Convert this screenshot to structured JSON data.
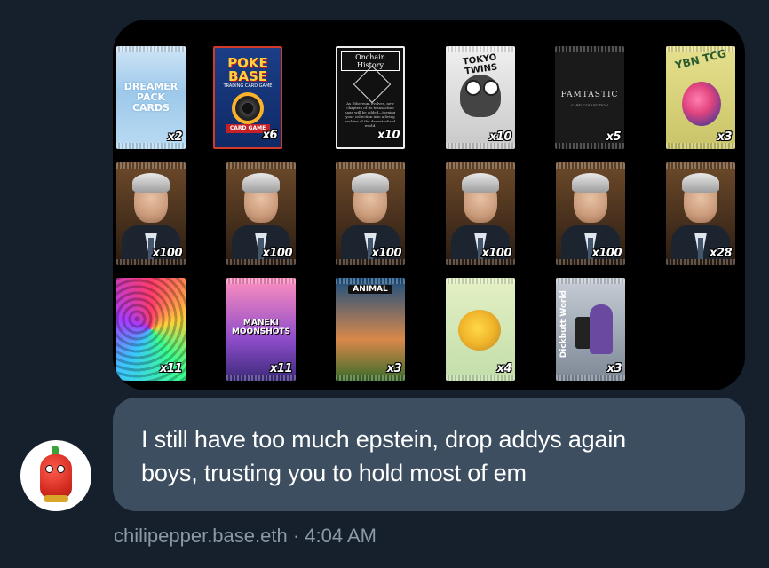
{
  "media": {
    "packs": [
      {
        "name": "dreamer-pack",
        "title": "DREAMER PACK CARDS",
        "count": "x2"
      },
      {
        "name": "poke-base-pack",
        "title": "POKE BASE",
        "subtitle": "TRADING CARD GAME",
        "footer": "CARD GAME",
        "count": "x6"
      },
      {
        "name": "onchain-history-pack",
        "title": "Onchain History",
        "text": "As Ethereum evolves, new chapters of its transaction saga will be added—turning your collection into a living archive of the decentralized world.",
        "count": "x10"
      },
      {
        "name": "tokyo-twins-pack",
        "title": "TOKYO TWINS",
        "count": "x10"
      },
      {
        "name": "famtastic-pack",
        "title": "FAMTASTIC",
        "subtitle": "CARD COLLECTION",
        "count": "x5"
      },
      {
        "name": "ybn-tcg-pack",
        "title": "YBN TCG",
        "count": "x3"
      },
      {
        "name": "portrait-pack-1",
        "count": "x100"
      },
      {
        "name": "portrait-pack-2",
        "count": "x100"
      },
      {
        "name": "portrait-pack-3",
        "count": "x100"
      },
      {
        "name": "portrait-pack-4",
        "count": "x100"
      },
      {
        "name": "portrait-pack-5",
        "count": "x100"
      },
      {
        "name": "portrait-pack-6",
        "count": "x28"
      },
      {
        "name": "psychedelic-pack",
        "count": "x11"
      },
      {
        "name": "maneki-moonshots-pack",
        "title": "MANEKI MOONSHOTS",
        "count": "x11"
      },
      {
        "name": "animal-pack",
        "title": "ANIMAL",
        "count": "x3"
      },
      {
        "name": "egg-pack",
        "count": "x4"
      },
      {
        "name": "dickbutt-world-pack",
        "title": "Dickbutt World",
        "count": "x3"
      }
    ]
  },
  "message": {
    "text_line1": "I still have too much epstein, drop addys again",
    "text_line2": "boys, trusting you to hold most of em",
    "author": "chilipepper.base.eth",
    "separator": "·",
    "time": "4:04 AM"
  },
  "colors": {
    "background": "#16202c",
    "bubble": "#3d4e60",
    "meta_text": "#8b98a5"
  }
}
